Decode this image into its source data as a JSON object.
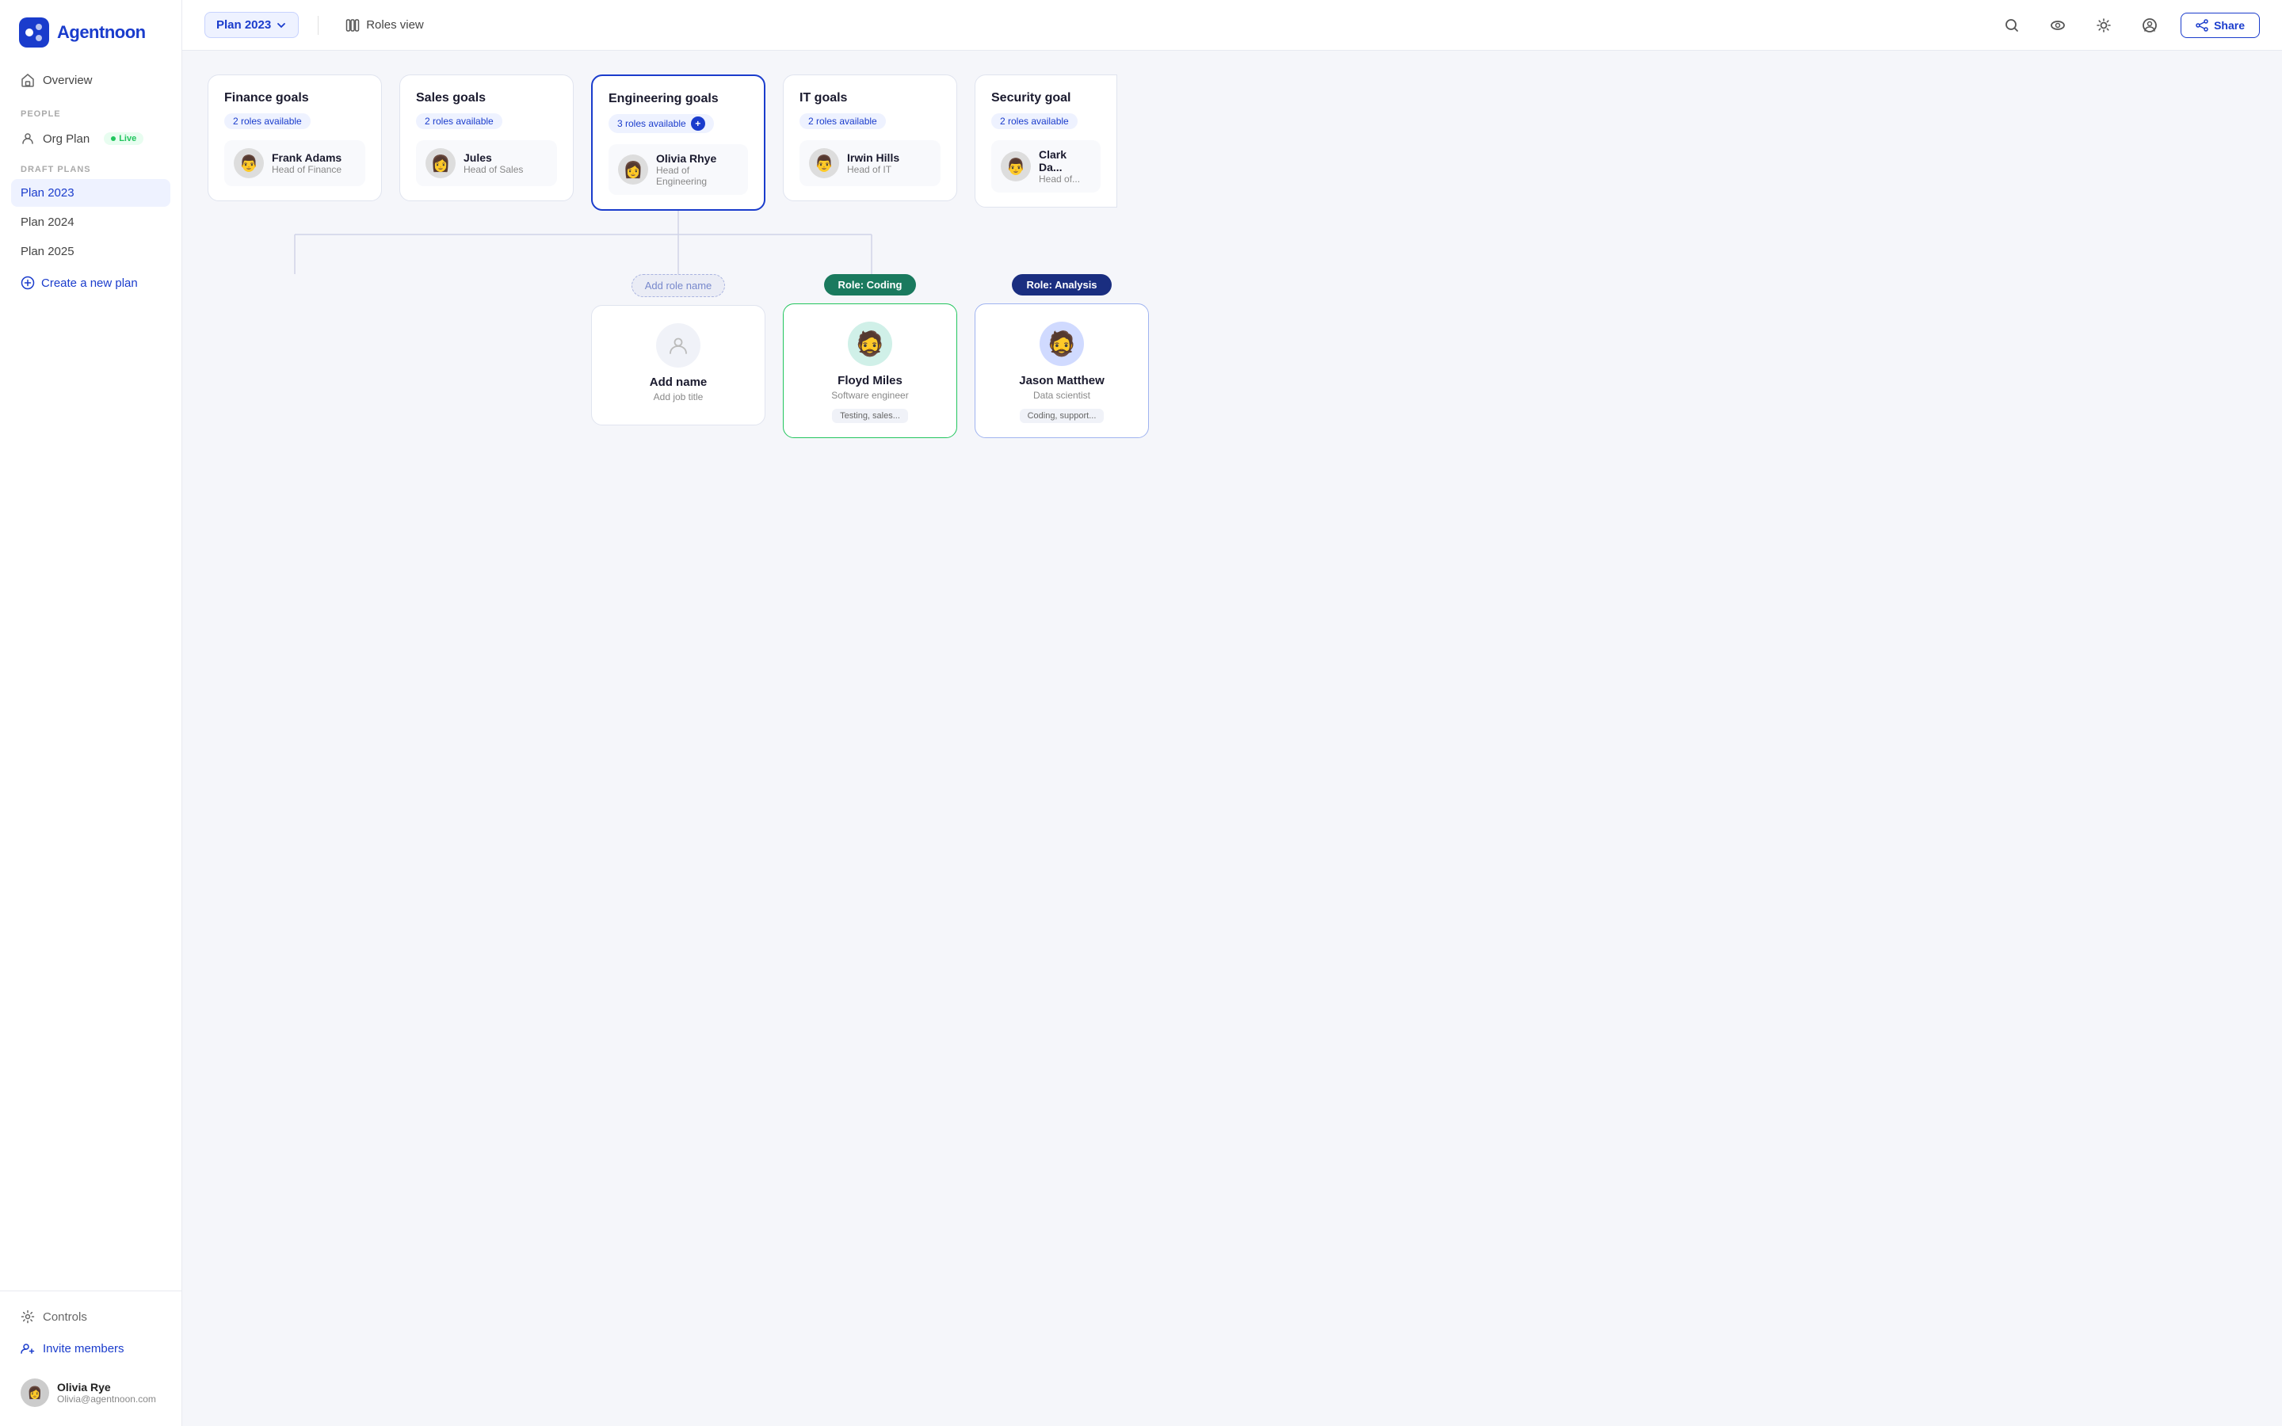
{
  "app": {
    "name": "Agentnoon"
  },
  "sidebar": {
    "overview_label": "Overview",
    "people_section": "PEOPLE",
    "org_plan_label": "Org Plan",
    "live_label": "Live",
    "draft_plans_section": "DRAFT PLANS",
    "plans": [
      {
        "label": "Plan 2023",
        "active": true
      },
      {
        "label": "Plan 2024",
        "active": false
      },
      {
        "label": "Plan 2025",
        "active": false
      }
    ],
    "create_plan_label": "Create a new plan",
    "controls_label": "Controls",
    "invite_label": "Invite members",
    "user": {
      "name": "Olivia Rye",
      "email": "Olivia@agentnoon.com",
      "avatar_emoji": "👩"
    }
  },
  "header": {
    "plan_selector": "Plan 2023",
    "roles_view": "Roles view",
    "share_label": "Share"
  },
  "departments": [
    {
      "title": "Finance goals",
      "roles_available": "2 roles available",
      "person_name": "Frank Adams",
      "person_title": "Head of Finance",
      "person_emoji": "👨",
      "active": false,
      "show_plus": false
    },
    {
      "title": "Sales goals",
      "roles_available": "2 roles available",
      "person_name": "Jules",
      "person_title": "Head of Sales",
      "person_emoji": "👩",
      "active": false,
      "show_plus": false
    },
    {
      "title": "Engineering goals",
      "roles_available": "3 roles available",
      "person_name": "Olivia Rhye",
      "person_title": "Head of Engineering",
      "person_emoji": "👩",
      "active": true,
      "show_plus": true
    },
    {
      "title": "IT goals",
      "roles_available": "2 roles available",
      "person_name": "Irwin Hills",
      "person_title": "Head of IT",
      "person_emoji": "👨",
      "active": false,
      "show_plus": false
    },
    {
      "title": "Security goal",
      "roles_available": "2 roles available",
      "person_name": "Clark Da...",
      "person_title": "Head of...",
      "person_emoji": "👨",
      "active": false,
      "show_plus": false,
      "partial": true
    }
  ],
  "roles": [
    {
      "badge_label": "Add role name",
      "badge_type": "add",
      "employee_name": "Add name",
      "employee_title": "Add job title",
      "employee_tags": null,
      "is_placeholder": true,
      "border_type": "default"
    },
    {
      "badge_label": "Role: Coding",
      "badge_type": "coding",
      "employee_name": "Floyd Miles",
      "employee_title": "Software engineer",
      "employee_tags": "Testing, sales...",
      "is_placeholder": false,
      "border_type": "green",
      "avatar_emoji": "🧔"
    },
    {
      "badge_label": "Role: Analysis",
      "badge_type": "analysis",
      "employee_name": "Jason Matthew",
      "employee_title": "Data scientist",
      "employee_tags": "Coding, support...",
      "is_placeholder": false,
      "border_type": "blue",
      "avatar_emoji": "🧔"
    }
  ]
}
